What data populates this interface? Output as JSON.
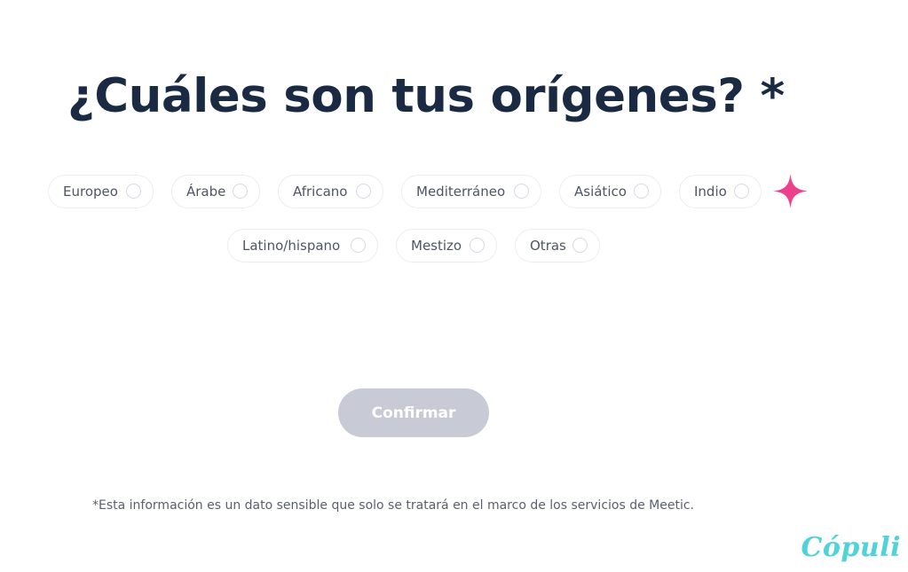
{
  "question": {
    "title": "¿Cuáles son tus orígenes? *"
  },
  "options": [
    {
      "label": "Europeo",
      "selected": false
    },
    {
      "label": "Árabe",
      "selected": false
    },
    {
      "label": "Africano",
      "selected": false
    },
    {
      "label": "Mediterráneo",
      "selected": false
    },
    {
      "label": "Asiático",
      "selected": false
    },
    {
      "label": "Indio",
      "selected": false
    },
    {
      "label": "Latino/hispano",
      "selected": false
    },
    {
      "label": "Mestizo",
      "selected": false
    },
    {
      "label": "Otras",
      "selected": false
    }
  ],
  "confirm": {
    "label": "Confirmar",
    "enabled": false
  },
  "footnote": "*Esta información es un dato sensible que solo se tratará en el marco de los servicios de Meetic.",
  "watermark": "Cópuli",
  "colors": {
    "title": "#1b2a43",
    "option_border": "#ecedf1",
    "option_text": "#4f5567",
    "button_disabled_bg": "#c8cad5",
    "sparkle": "#ec3f8c",
    "watermark": "#4fd3d6"
  },
  "icons": {
    "sparkle": "sparkle-icon",
    "radio": "radio-circle-icon"
  }
}
